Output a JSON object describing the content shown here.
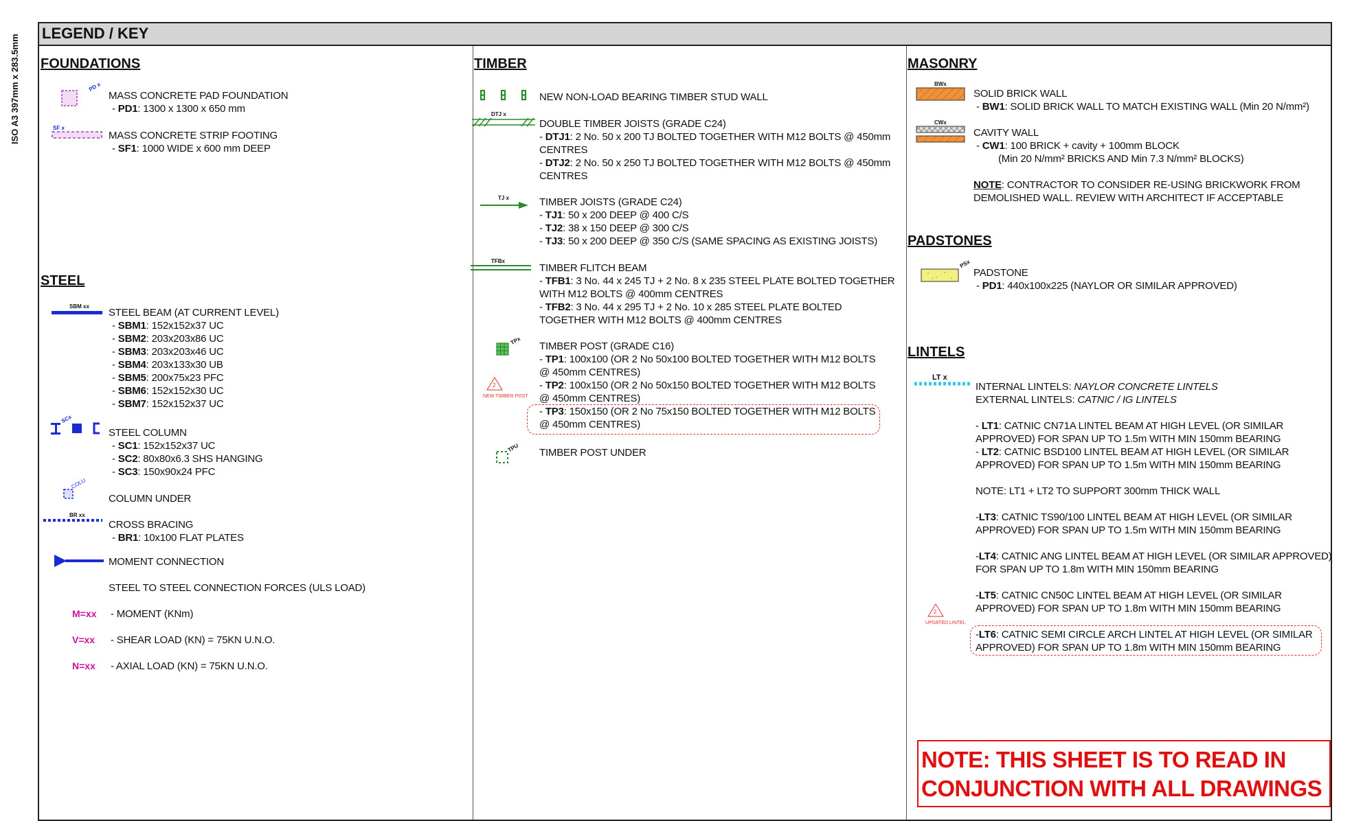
{
  "sheet_size": "ISO A3 397mm x 283.5mm",
  "title": "LEGEND / KEY",
  "foundations": {
    "heading": "FOUNDATIONS",
    "pad": {
      "tag": "PD x",
      "line1": "MASS CONCRETE PAD FOUNDATION",
      "code": "PD1",
      "detail": ": 1300 x 1300 x 650 mm"
    },
    "strip": {
      "tag": "SF x",
      "line1": "MASS CONCRETE STRIP FOOTING",
      "code": "SF1",
      "detail": ": 1000 WIDE x 600 mm DEEP"
    }
  },
  "steel": {
    "heading": "STEEL",
    "beam": {
      "tag": "SBM xx",
      "line1": "STEEL BEAM (AT CURRENT LEVEL)",
      "items": [
        {
          "code": "SBM1",
          "detail": ": 152x152x37 UC"
        },
        {
          "code": "SBM2",
          "detail": ": 203x203x86 UC"
        },
        {
          "code": "SBM3",
          "detail": ": 203x203x46 UC"
        },
        {
          "code": "SBM4",
          "detail": ": 203x133x30 UB"
        },
        {
          "code": "SBM5",
          "detail": ": 200x75x23 PFC"
        },
        {
          "code": "SBM6",
          "detail": ": 152x152x30 UC"
        },
        {
          "code": "SBM7",
          "detail": ": 152x152x37 UC"
        }
      ]
    },
    "column": {
      "tag": "SCx",
      "line1": "STEEL COLUMN",
      "items": [
        {
          "code": "SC1",
          "detail": ": 152x152x37 UC"
        },
        {
          "code": "SC2",
          "detail": ": 80x80x6.3 SHS HANGING"
        },
        {
          "code": "SC3",
          "detail": ": 150x90x24 PFC"
        }
      ]
    },
    "column_under": {
      "tag": "COLU",
      "line1": "COLUMN UNDER"
    },
    "bracing": {
      "tag": "BR xx",
      "line1": "CROSS BRACING",
      "code": "BR1",
      "detail": ": 10x100 FLAT PLATES"
    },
    "moment": {
      "line1": "MOMENT CONNECTION"
    },
    "forces_heading": "STEEL TO STEEL CONNECTION FORCES (ULS LOAD)",
    "forces": [
      {
        "symbol": "M=xx",
        "label": "- MOMENT (KNm)"
      },
      {
        "symbol": "V=xx",
        "label": "- SHEAR LOAD (KN) = 75KN U.N.O."
      },
      {
        "symbol": "N=xx",
        "label": "- AXIAL LOAD (KN) = 75KN U.N.O."
      }
    ]
  },
  "timber": {
    "heading": "TIMBER",
    "stud": {
      "line1": "NEW NON-LOAD BEARING TIMBER STUD WALL"
    },
    "dtj": {
      "tag": "DTJ x",
      "line1": "DOUBLE TIMBER JOISTS (GRADE C24)",
      "items": [
        {
          "code": "DTJ1",
          "detail": ": 2 No. 50 x 200 TJ BOLTED TOGETHER WITH M12 BOLTS @ 450mm CENTRES"
        },
        {
          "code": "DTJ2",
          "detail": ": 2 No. 50 x 250 TJ BOLTED TOGETHER WITH M12 BOLTS @ 450mm CENTRES"
        }
      ]
    },
    "tj": {
      "tag": "TJ x",
      "line1": "TIMBER JOISTS (GRADE C24)",
      "items": [
        {
          "code": "TJ1",
          "detail": ": 50 x 200 DEEP @ 400 C/S"
        },
        {
          "code": "TJ2",
          "detail": ": 38 x 150 DEEP @ 300 C/S"
        },
        {
          "code": "TJ3",
          "detail": ": 50 x 200 DEEP @ 350 C/S (SAME SPACING AS EXISTING JOISTS)"
        }
      ]
    },
    "tfb": {
      "tag": "TFBx",
      "line1": "TIMBER FLITCH BEAM",
      "items": [
        {
          "code": "TFB1",
          "detail": ": 3 No. 44 x 245 TJ + 2 No. 8 x 235 STEEL PLATE BOLTED TOGETHER WITH M12 BOLTS @ 400mm CENTRES"
        },
        {
          "code": "TFB2",
          "detail": ": 3 No. 44 x 295 TJ + 2 No. 10 x 285 STEEL PLATE BOLTED TOGETHER WITH M12 BOLTS @ 400mm CENTRES"
        }
      ]
    },
    "tp": {
      "tag": "TPx",
      "line1": "TIMBER POST (GRADE C16)",
      "items": [
        {
          "code": "TP1",
          "detail": ": 100x100 (OR 2 No 50x100 BOLTED TOGETHER WITH M12 BOLTS @ 450mm CENTRES)"
        },
        {
          "code": "TP2",
          "detail": ": 100x150 (OR 2 No 50x150 BOLTED TOGETHER WITH M12 BOLTS @ 450mm CENTRES)"
        },
        {
          "code": "TP3",
          "detail": ": 150x150 (OR 2 No 75x150 BOLTED TOGETHER WITH M12 BOLTS @ 450mm CENTRES)"
        }
      ]
    },
    "rev_mark": {
      "number": "2",
      "label": "NEW TIMBER POST"
    },
    "tpu": {
      "tag": "TPU",
      "line1": "TIMBER POST UNDER"
    }
  },
  "masonry": {
    "heading": "MASONRY",
    "brick": {
      "tag": "BWx",
      "line1": "SOLID BRICK WALL",
      "code": "BW1",
      "detail": ": SOLID BRICK WALL TO MATCH EXISTING WALL (Min 20 N/mm²)"
    },
    "cavity": {
      "tag": "CWx",
      "line1": "CAVITY WALL",
      "code": "CW1",
      "detail": ": 100 BRICK + cavity + 100mm BLOCK",
      "line3": "(Min 20 N/mm² BRICKS AND Min 7.3 N/mm² BLOCKS)"
    },
    "note_label": "NOTE",
    "note_text": ": CONTRACTOR TO CONSIDER RE-USING BRICKWORK FROM",
    "note_text2": "DEMOLISHED WALL. REVIEW WITH ARCHITECT IF ACCEPTABLE"
  },
  "padstones": {
    "heading": "PADSTONES",
    "tag": "PSx",
    "line1": "PADSTONE",
    "code": "PD1",
    "detail": ":  440x100x225 (NAYLOR OR SIMILAR APPROVED)"
  },
  "lintels": {
    "heading": "LINTELS",
    "tag": "LT x",
    "internal_label": "INTERNAL LINTELS: ",
    "internal_value": "NAYLOR CONCRETE LINTELS",
    "external_label": "EXTERNAL LINTELS: ",
    "external_value": "CATNIC / IG LINTELS",
    "items": [
      {
        "prefix": "- ",
        "code": "LT1",
        "detail": ": CATNIC CN71A LINTEL BEAM AT HIGH LEVEL (OR SIMILAR",
        "detail2": "APPROVED) FOR SPAN UP TO 1.5m WITH MIN 150mm BEARING"
      },
      {
        "prefix": "- ",
        "code": "LT2",
        "detail": ": CATNIC BSD100 LINTEL BEAM AT HIGH LEVEL (OR SIMILAR",
        "detail2": "APPROVED) FOR SPAN UP TO 1.5m WITH MIN 150mm BEARING"
      }
    ],
    "note": "NOTE: LT1 + LT2 TO SUPPORT 300mm THICK WALL",
    "items2": [
      {
        "prefix": "-",
        "code": "LT3",
        "detail": ": CATNIC TS90/100 LINTEL BEAM AT HIGH LEVEL (OR SIMILAR",
        "detail2": "APPROVED) FOR SPAN UP TO 1.5m WITH MIN 150mm BEARING"
      },
      {
        "prefix": "-",
        "code": "LT4",
        "detail": ": CATNIC ANG LINTEL BEAM AT HIGH LEVEL (OR SIMILAR APPROVED)",
        "detail2": "FOR SPAN UP TO 1.8m WITH MIN 150mm BEARING"
      },
      {
        "prefix": "-",
        "code": "LT5",
        "detail": ": CATNIC CN50C LINTEL BEAM AT HIGH LEVEL (OR SIMILAR",
        "detail2": "APPROVED) FOR SPAN UP TO 1.8m WITH MIN 150mm BEARING"
      },
      {
        "prefix": "-",
        "code": "LT6",
        "detail": ": CATNIC SEMI CIRCLE ARCH LINTEL AT HIGH LEVEL (OR SIMILAR",
        "detail2": "APPROVED) FOR SPAN UP TO 1.8m WITH MIN 150mm BEARING"
      }
    ],
    "rev_mark": {
      "number": "2",
      "label": "UPDATED LINTEL"
    }
  },
  "sheet_note": {
    "line1": "NOTE: THIS SHEET IS TO READ IN",
    "line2": "CONJUNCTION WITH ALL DRAWINGS"
  },
  "colors": {
    "steel_blue": "#1a2bd6",
    "timber_green": "#2a8a2a",
    "force_magenta": "#d0109a",
    "revision_red": "#e03030",
    "brick_orange": "#f0923a",
    "padstone_yellow": "#f4f080"
  }
}
